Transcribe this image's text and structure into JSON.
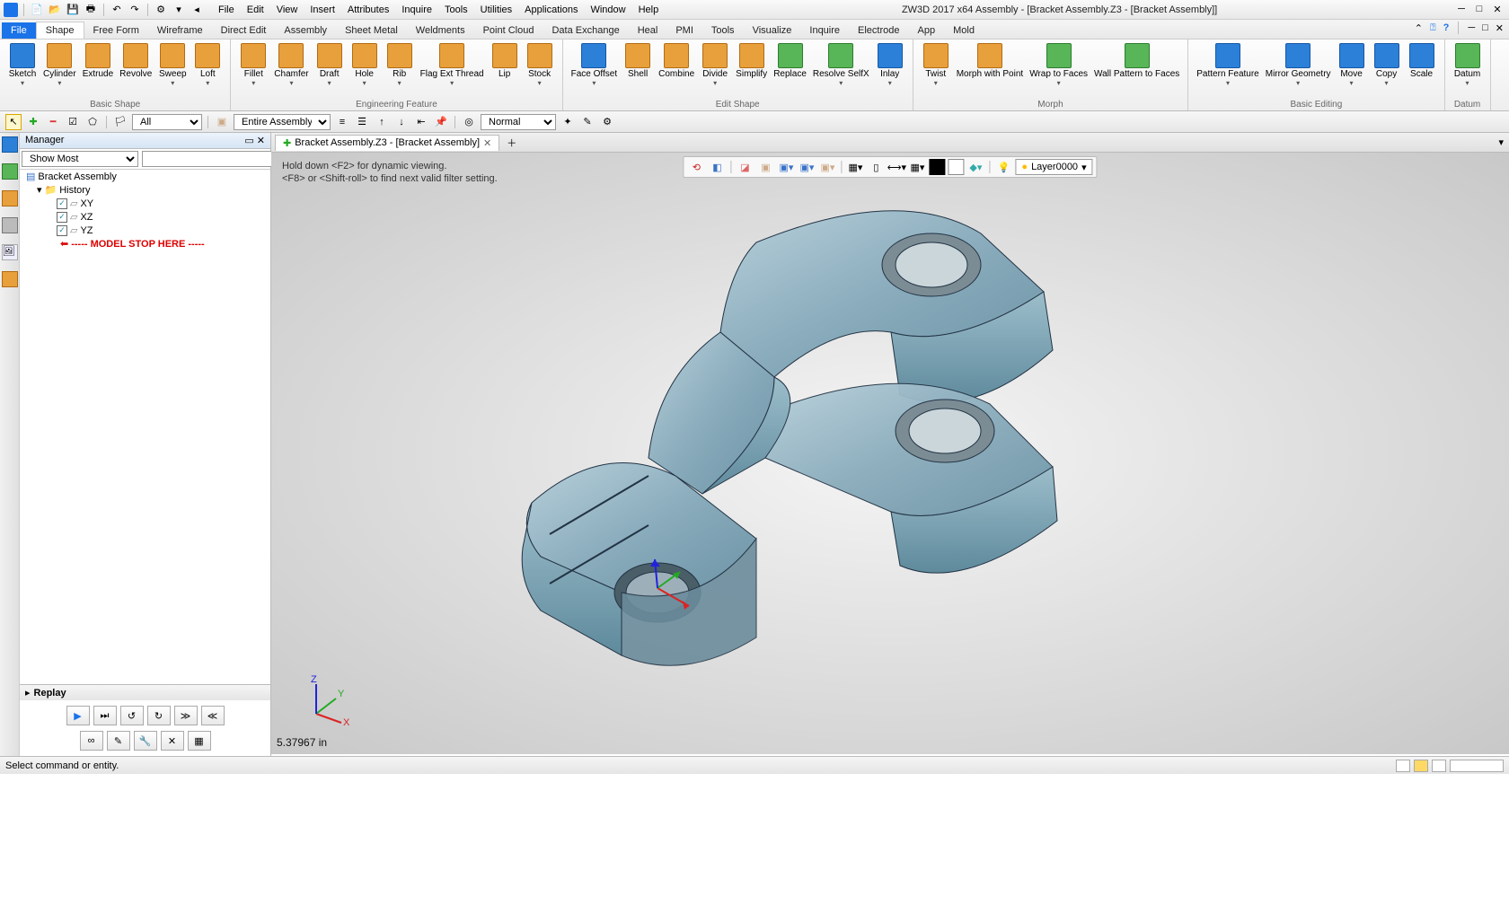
{
  "app": {
    "title": "ZW3D 2017  x64     Assembly - [Bracket Assembly.Z3 - [Bracket Assembly]]"
  },
  "menus": [
    "File",
    "Edit",
    "View",
    "Insert",
    "Attributes",
    "Inquire",
    "Tools",
    "Utilities",
    "Applications",
    "Window",
    "Help"
  ],
  "ribbonTabs": [
    "File",
    "Shape",
    "Free Form",
    "Wireframe",
    "Direct Edit",
    "Assembly",
    "Sheet Metal",
    "Weldments",
    "Point Cloud",
    "Data Exchange",
    "Heal",
    "PMI",
    "Tools",
    "Visualize",
    "Inquire",
    "Electrode",
    "App",
    "Mold"
  ],
  "activeTab": "Shape",
  "ribbonGroups": [
    {
      "label": "Basic Shape",
      "buttons": [
        {
          "label": "Sketch",
          "arrow": true,
          "color": "ic-blue"
        },
        {
          "label": "Cylinder",
          "arrow": true,
          "color": "ic-orange"
        },
        {
          "label": "Extrude",
          "color": "ic-orange"
        },
        {
          "label": "Revolve",
          "color": "ic-orange"
        },
        {
          "label": "Sweep",
          "arrow": true,
          "color": "ic-orange"
        },
        {
          "label": "Loft",
          "arrow": true,
          "color": "ic-orange"
        }
      ]
    },
    {
      "label": "Engineering Feature",
      "buttons": [
        {
          "label": "Fillet",
          "arrow": true,
          "color": "ic-orange"
        },
        {
          "label": "Chamfer",
          "arrow": true,
          "color": "ic-orange"
        },
        {
          "label": "Draft",
          "arrow": true,
          "color": "ic-orange"
        },
        {
          "label": "Hole",
          "arrow": true,
          "color": "ic-orange"
        },
        {
          "label": "Rib",
          "arrow": true,
          "color": "ic-orange"
        },
        {
          "label": "Flag Ext Thread",
          "arrow": true,
          "color": "ic-orange"
        },
        {
          "label": "Lip",
          "color": "ic-orange"
        },
        {
          "label": "Stock",
          "arrow": true,
          "color": "ic-orange"
        }
      ]
    },
    {
      "label": "Edit Shape",
      "buttons": [
        {
          "label": "Face Offset",
          "arrow": true,
          "color": "ic-blue"
        },
        {
          "label": "Shell",
          "color": "ic-orange"
        },
        {
          "label": "Combine",
          "color": "ic-orange"
        },
        {
          "label": "Divide",
          "arrow": true,
          "color": "ic-orange"
        },
        {
          "label": "Simplify",
          "color": "ic-orange"
        },
        {
          "label": "Replace",
          "color": "ic-green"
        },
        {
          "label": "Resolve SelfX",
          "arrow": true,
          "color": "ic-green"
        },
        {
          "label": "Inlay",
          "arrow": true,
          "color": "ic-blue"
        }
      ]
    },
    {
      "label": "Morph",
      "buttons": [
        {
          "label": "Twist",
          "arrow": true,
          "color": "ic-orange"
        },
        {
          "label": "Morph with Point",
          "color": "ic-orange"
        },
        {
          "label": "Wrap to Faces",
          "arrow": true,
          "color": "ic-green"
        },
        {
          "label": "Wall Pattern to Faces",
          "color": "ic-green"
        }
      ]
    },
    {
      "label": "Basic Editing",
      "buttons": [
        {
          "label": "Pattern Feature",
          "arrow": true,
          "color": "ic-blue"
        },
        {
          "label": "Mirror Geometry",
          "arrow": true,
          "color": "ic-blue"
        },
        {
          "label": "Move",
          "arrow": true,
          "color": "ic-blue"
        },
        {
          "label": "Copy",
          "arrow": true,
          "color": "ic-blue"
        },
        {
          "label": "Scale",
          "color": "ic-blue"
        }
      ]
    },
    {
      "label": "Datum",
      "buttons": [
        {
          "label": "Datum",
          "arrow": true,
          "color": "ic-green"
        }
      ]
    }
  ],
  "toolbar2": {
    "filter": "All",
    "scope": "Entire Assembly",
    "display": "Normal"
  },
  "manager": {
    "title": "Manager",
    "showMode": "Show Most",
    "root": "Bracket Assembly",
    "history": "History",
    "planes": [
      "XY",
      "XZ",
      "YZ"
    ],
    "modelStop": "----- MODEL STOP HERE -----",
    "replay": "Replay"
  },
  "viewport": {
    "tab": "Bracket Assembly.Z3 - [Bracket Assembly]",
    "hint1": "Hold down <F2> for dynamic viewing.",
    "hint2": "<F8> or <Shift-roll> to find next valid filter setting.",
    "coord": "5.37967 in",
    "layer": "Layer0000"
  },
  "statusbar": {
    "prompt": "Select command or entity."
  }
}
